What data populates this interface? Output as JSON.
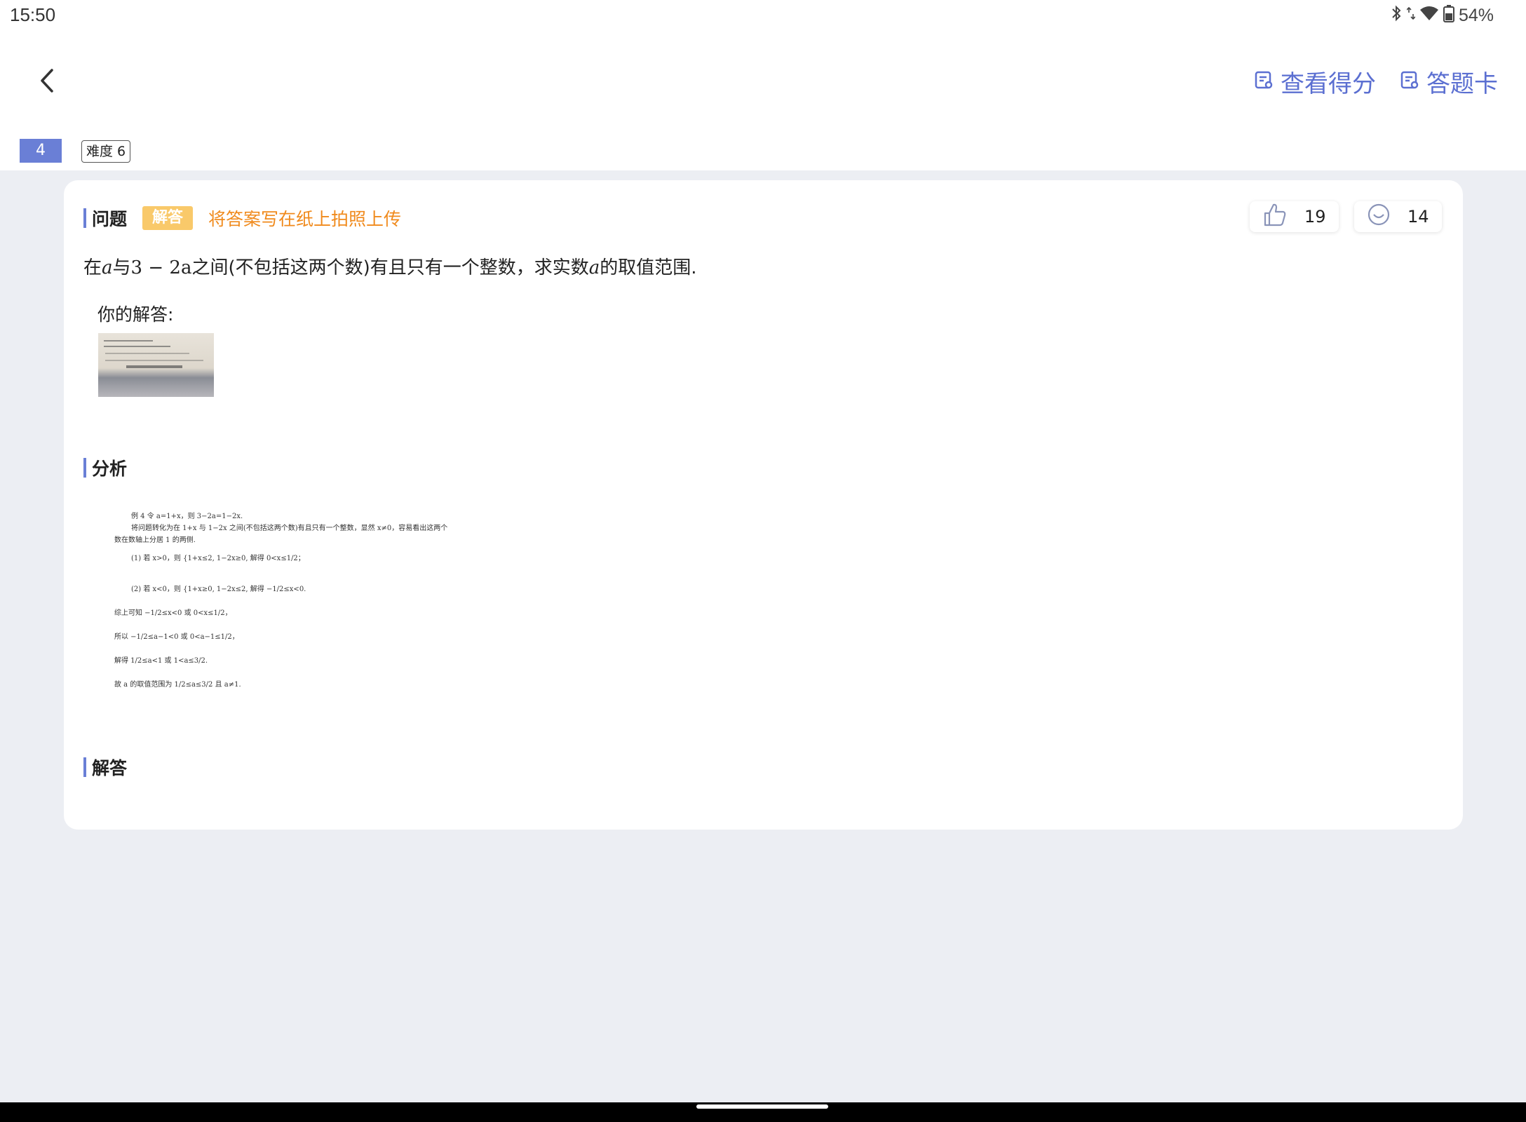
{
  "status": {
    "time": "15:50",
    "battery": "54%",
    "icons": [
      "bluetooth-icon",
      "data-arrows-icon",
      "wifi-icon",
      "battery-icon"
    ]
  },
  "header": {
    "view_score": "查看得分",
    "answer_card": "答题卡"
  },
  "question_meta": {
    "number": "4",
    "difficulty": "难度 6"
  },
  "question": {
    "section_title": "问题",
    "type_tag": "解答",
    "hint": "将答案写在纸上拍照上传",
    "likes": "19",
    "comments": "14",
    "text_pre": "在",
    "var_a": "a",
    "text_mid": "与",
    "expr": "3 − 2a",
    "text_post": "之间(不包括这两个数)有且只有一个整数，求实数",
    "var_a2": "a",
    "text_end": "的取值范围.",
    "your_answer_label": "你的解答:"
  },
  "analysis": {
    "section_title": "分析",
    "lines": [
      "例 4  令 a=1+x，则 3−2a=1−2x.",
      "将问题转化为在 1+x 与 1−2x 之间(不包括这两个数)有且只有一个整数，显然 x≠0，容易看出这两个",
      "数在数轴上分居 1 的两侧.",
      "(1) 若 x>0，则 {1+x≤2, 1−2x≥0,  解得 0<x≤1/2；",
      "(2) 若 x<0，则 {1+x≥0, 1−2x≤2,  解得 −1/2≤x<0.",
      "综上可知                −1/2≤x<0 或 0<x≤1/2，",
      "所以                  −1/2≤a−1<0 或 0<a−1≤1/2，",
      "解得                   1/2≤a<1 或 1<a≤3/2.",
      "故 a 的取值范围为          1/2≤a≤3/2 且 a≠1."
    ]
  },
  "solution": {
    "section_title": "解答"
  }
}
